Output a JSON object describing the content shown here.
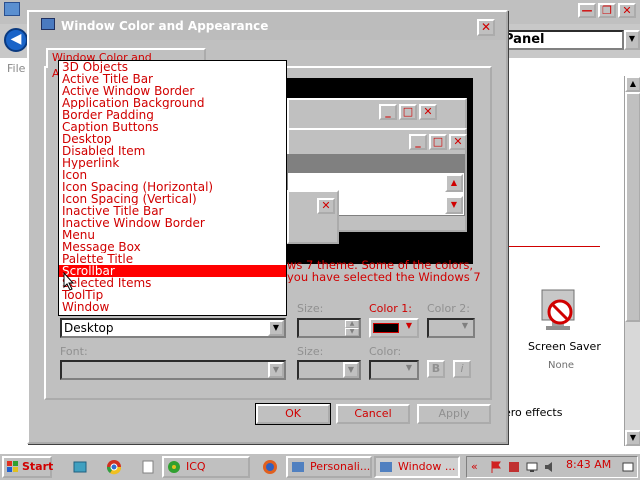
{
  "background_window": {
    "title_controls": {
      "minimize": "—",
      "maximize": "❐",
      "close": "✕"
    },
    "address": "Panel",
    "menu_file": "File",
    "screen_saver_label": "Screen Saver",
    "screen_saver_value": "None",
    "aero_text": "ero effects"
  },
  "dialog": {
    "title": "Window Color and Appearance",
    "tab_label": "Window Color and Appearance",
    "note_line1": "ws 7 theme.  Some of the colors,",
    "note_line2": " you have selected the Windows 7",
    "item_label": "Item:",
    "item_value": "Desktop",
    "size_label": "Size:",
    "color1_label": "Color 1:",
    "color2_label": "Color 2:",
    "font_label": "Font:",
    "font_size_label": "Size:",
    "font_color_label": "Color:",
    "bold_label": "B",
    "italic_label": "i",
    "ok_label": "OK",
    "cancel_label": "Cancel",
    "apply_label": "Apply"
  },
  "item_list": {
    "items": [
      "3D Objects",
      "Active Title Bar",
      "Active Window Border",
      "Application Background",
      "Border Padding",
      "Caption Buttons",
      "Desktop",
      "Disabled Item",
      "Hyperlink",
      "Icon",
      "Icon Spacing (Horizontal)",
      "Icon Spacing (Vertical)",
      "Inactive Title Bar",
      "Inactive Window Border",
      "Menu",
      "Message Box",
      "Palette Title",
      "Scrollbar",
      "Selected Items",
      "ToolTip",
      "Window"
    ],
    "selected": "Scrollbar"
  },
  "taskbar": {
    "start_label": "Start",
    "icq_label": "ICQ",
    "personalization_label": "Personali...",
    "window_label": "Window ...",
    "clock": "8:43 AM",
    "tray_chevron": "«"
  },
  "colors": {
    "accent": "#d00000",
    "selection": "#ff0000",
    "face": "#c0c0c0"
  }
}
